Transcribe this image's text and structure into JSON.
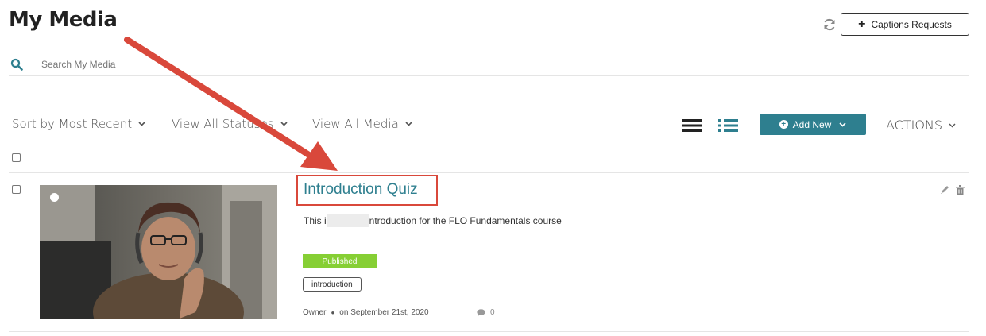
{
  "header": {
    "title": "My Media",
    "captions_button_label": "Captions Requests"
  },
  "search": {
    "placeholder": "Search My Media",
    "value": ""
  },
  "filters": {
    "sort_label": "Sort by Most Recent",
    "status_label": "View All Statuses",
    "media_label": "View All Media"
  },
  "toolbar": {
    "add_new_label": "Add New",
    "actions_label": "ACTIONS"
  },
  "media_items": [
    {
      "title": "Introduction Quiz",
      "description_start": "This i",
      "description_end": "ntroduction for the FLO Fundamentals course",
      "status": "Published",
      "tag": "introduction",
      "owner": "Owner",
      "date": "on September 21st, 2020",
      "comment_count": "0"
    }
  ],
  "colors": {
    "accent": "#2e7f8f",
    "published": "#86cf34",
    "highlight_red": "#d9483b"
  },
  "icons": [
    "refresh-icon",
    "plus-icon",
    "search-icon",
    "chevron-down-icon",
    "list-view-icon",
    "detailed-view-icon",
    "edit-icon",
    "trash-icon",
    "comment-icon"
  ]
}
